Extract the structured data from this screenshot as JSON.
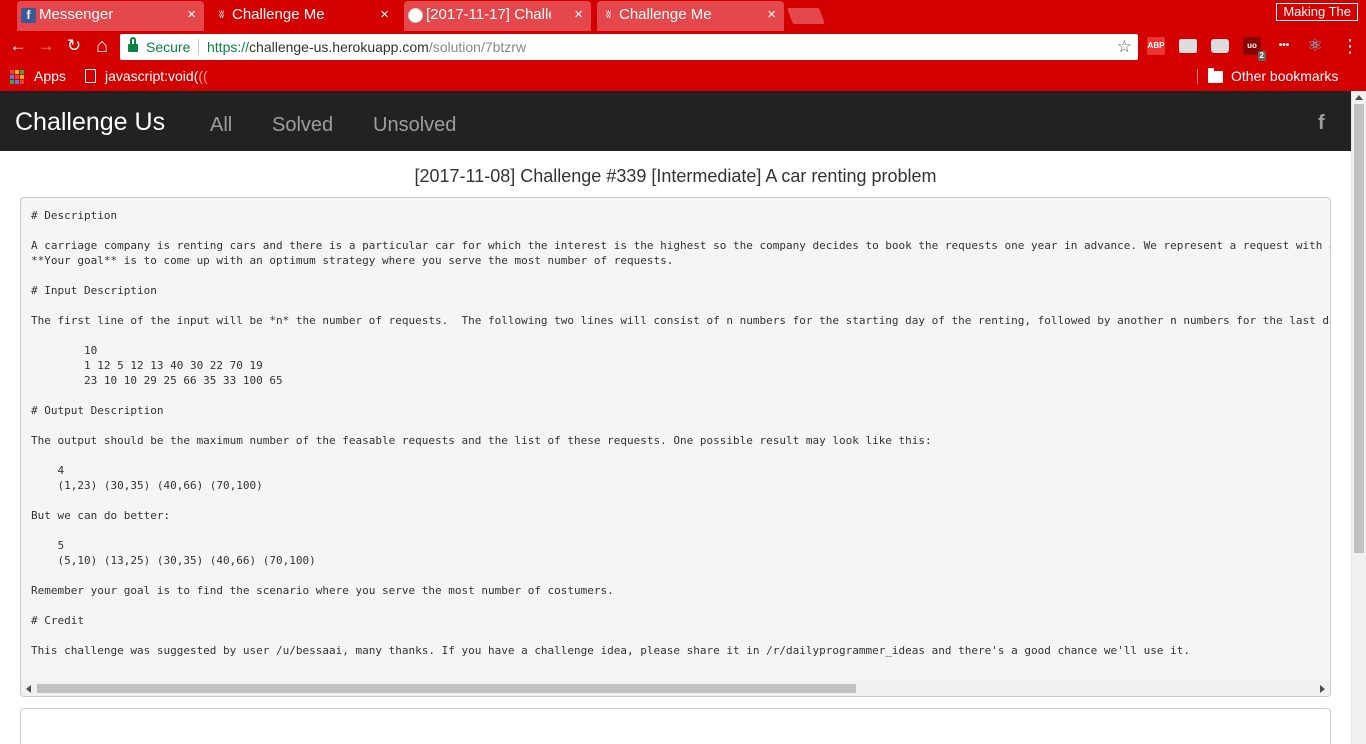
{
  "browser": {
    "tabs": [
      {
        "title": "Messenger",
        "icon": "facebook-icon",
        "icon_glyph": "f",
        "active": false
      },
      {
        "title": "Challenge Me",
        "icon": "challenge-favicon",
        "icon_glyph": "ʬ",
        "active": true
      },
      {
        "title": "[2017-11-17] Challe",
        "icon": "reddit-icon",
        "icon_glyph": "",
        "active": false
      },
      {
        "title": "Challenge Me",
        "icon": "challenge-favicon",
        "icon_glyph": "ʬ",
        "active": false
      }
    ],
    "close_glyph": "×",
    "profile_label": "Making The",
    "nav": {
      "back": "←",
      "forward": "→",
      "reload": "↻",
      "home": "⌂"
    },
    "omnibox": {
      "secure_label": "Secure",
      "url_scheme": "https://",
      "url_host": "challenge-us.herokuapp.com",
      "url_path": "/solution/7btzrw",
      "star_glyph": "☆"
    },
    "extensions": [
      {
        "name": "adblock-plus-icon",
        "label": "ABP",
        "color": "#e33"
      },
      {
        "name": "clapper-extension-icon",
        "label": "",
        "color": "#ddd"
      },
      {
        "name": "chat-extension-icon",
        "label": "",
        "color": "#ddd"
      },
      {
        "name": "ublock-icon",
        "label": "uo",
        "badge": "2",
        "color": "#800"
      },
      {
        "name": "dots-extension-icon",
        "label": "•••",
        "color": "#d40000"
      },
      {
        "name": "react-devtools-icon",
        "label": "⚛",
        "color": "#61dafb"
      }
    ],
    "menu_glyph": "⋮",
    "bookmarks": {
      "apps_label": "Apps",
      "js_label": "javascript:void(",
      "js_suffix": "((",
      "other_label": "Other bookmarks"
    },
    "colors": {
      "chrome_red": "#d40000",
      "tab_inactive": "#e4484c"
    }
  },
  "site": {
    "brand": "Challenge Us",
    "nav": [
      {
        "label": "All"
      },
      {
        "label": "Solved"
      },
      {
        "label": "Unsolved"
      }
    ],
    "facebook_glyph": "f",
    "navbar_color": "#222222"
  },
  "challenge": {
    "title": "[2017-11-08] Challenge #339 [Intermediate] A car renting problem",
    "body_lines": [
      "# Description",
      "",
      "A carriage company is renting cars and there is a particular car for which the interest is the highest so the company decides to book the requests one year in advance. We represent a request with a",
      "**Your goal** is to come up with an optimum strategy where you serve the most number of requests.",
      "",
      "# Input Description",
      "",
      "The first line of the input will be *n* the number of requests.  The following two lines will consist of n numbers for the starting day of the renting, followed by another n numbers for the last da",
      "",
      "        10",
      "        1 12 5 12 13 40 30 22 70 19",
      "        23 10 10 29 25 66 35 33 100 65",
      "",
      "# Output Description",
      "",
      "The output should be the maximum number of the feasable requests and the list of these requests. One possible result may look like this:",
      "",
      "    4",
      "    (1,23) (30,35) (40,66) (70,100)",
      "",
      "But we can do better:",
      "",
      "    5",
      "    (5,10) (13,25) (30,35) (40,66) (70,100)",
      "",
      "Remember your goal is to find the scenario where you serve the most number of costumers.",
      "",
      "# Credit",
      "",
      "This challenge was suggested by user /u/bessaai, many thanks. If you have a challenge idea, please share it in /r/dailyprogrammer_ideas and there's a good chance we'll use it."
    ]
  }
}
